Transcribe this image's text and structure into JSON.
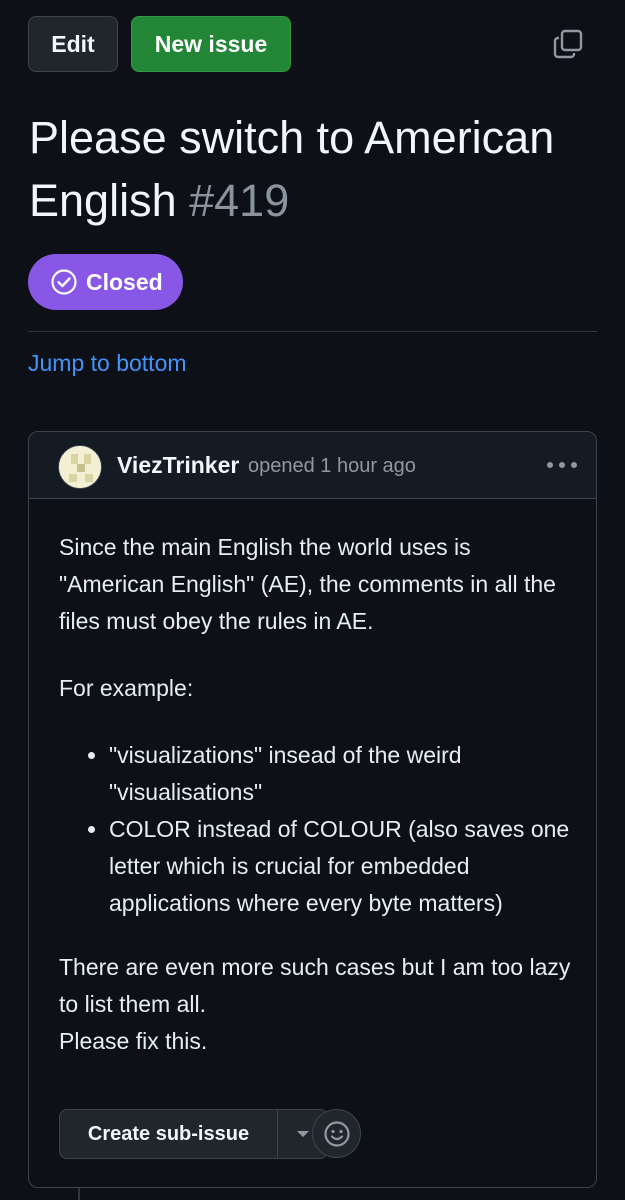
{
  "toolbar": {
    "edit_label": "Edit",
    "new_issue_label": "New issue",
    "copy_icon": "copy-icon"
  },
  "issue": {
    "title": "Please switch to American English",
    "number": "#419",
    "state": "Closed",
    "state_color": "#8957e5"
  },
  "jump_link": "Jump to bottom",
  "comment": {
    "author": "ViezTrinker",
    "meta": "opened 1 hour ago",
    "paragraphs": [
      "Since the main English the world uses is \"American English\" (AE), the comments in all the files must obey the rules in AE.",
      "For example:"
    ],
    "bullets": [
      "\"visualizations\" insead of the weird \"visualisations\"",
      "COLOR instead of COLOUR (also saves one letter which is crucial for embedded applications where every byte matters)"
    ],
    "closing_lines": [
      "There are even more such cases but I am too lazy to list them all.",
      "Please fix this."
    ],
    "create_subissue_label": "Create sub-issue"
  },
  "colors": {
    "background": "#0d1117",
    "primary_green": "#238636",
    "link_blue": "#4493f8",
    "closed_purple": "#8957e5"
  }
}
